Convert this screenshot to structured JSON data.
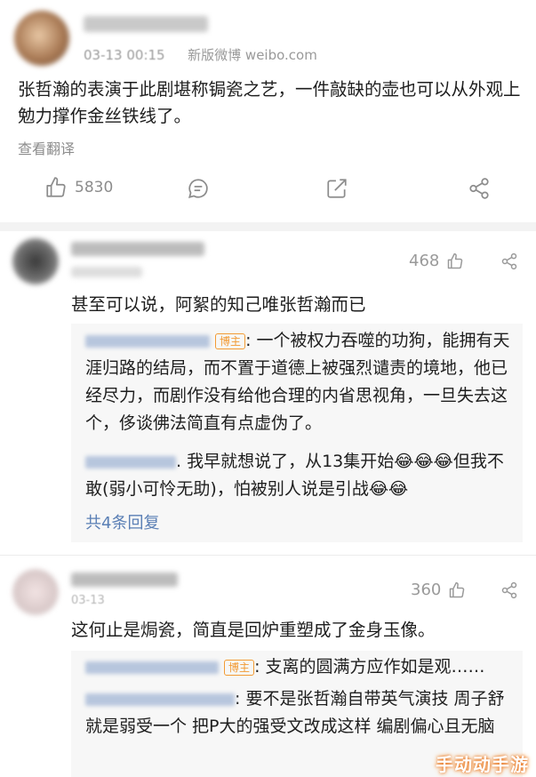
{
  "post": {
    "timestamp": "03-13 00:15",
    "source": "新版微博 weibo.com",
    "body": "张哲瀚的表演于此剧堪称锔瓷之艺，一件敲缺的壶也可以从外观上勉力撑作金丝铁线了。",
    "translate_label": "查看翻译",
    "like_count": "5830",
    "icons": [
      "thumbs-up-icon",
      "comment-icon",
      "repost-icon",
      "share-icon"
    ]
  },
  "comments": [
    {
      "likes": "468",
      "text": "甚至可以说，阿絮的知己唯张哲瀚而已",
      "replies": [
        {
          "badge": "博主",
          "text": ": 一个被权力吞噬的功狗，能拥有天涯归路的结局，而不置于道德上被强烈谴责的境地，他已经尽力，而剧作没有给他合理的内省思视角，一旦失去这个，侈谈佛法简直有点虚伪了。"
        },
        {
          "badge": "",
          "text": ". 我早就想说了，从13集开始😂😂😂但我不敢(弱小可怜无助)，怕被别人说是引战😂😂"
        }
      ],
      "more_replies": "共4条回复"
    },
    {
      "likes": "360",
      "timestamp_fragment": "03-13",
      "text": "这何止是焗瓷，简直是回炉重塑成了金身玉像。",
      "replies": [
        {
          "badge": "博主",
          "text": ": 支离的圆满方应作如是观……"
        },
        {
          "badge": "",
          "text": ": 要不是张哲瀚自带英气演技 周子舒就是弱受一个 把P大的强受文改成这样 编剧偏心且无脑"
        }
      ]
    }
  ],
  "watermark": "手动动手游",
  "colors": {
    "link": "#5a7fb5",
    "badge": "#f29b34",
    "grey": "#999999"
  }
}
